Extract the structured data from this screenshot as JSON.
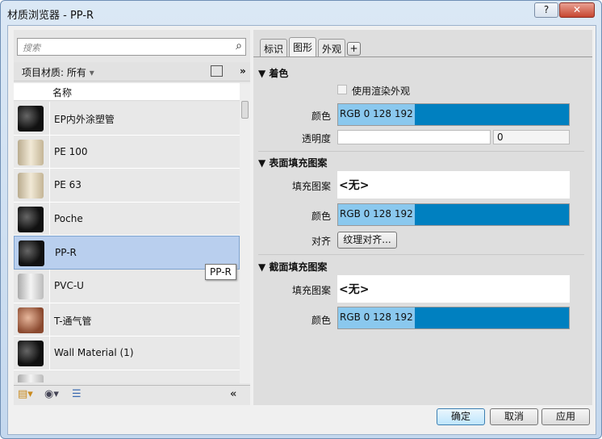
{
  "window": {
    "title": "材质浏览器 - PP-R",
    "help": "?",
    "close": "✕"
  },
  "left": {
    "search_placeholder": "搜索",
    "filter_label": "项目材质: 所有",
    "column_name": "名称",
    "materials": [
      {
        "name": "EP内外涂塑管",
        "swatch": "black"
      },
      {
        "name": "PE 100",
        "swatch": "cream"
      },
      {
        "name": "PE 63",
        "swatch": "cream"
      },
      {
        "name": "Poche",
        "swatch": "black"
      },
      {
        "name": "PP-R",
        "swatch": "black",
        "selected": true
      },
      {
        "name": "PVC-U",
        "swatch": "grey"
      },
      {
        "name": "T-通气管",
        "swatch": "copper"
      },
      {
        "name": "Wall Material (1)",
        "swatch": "black"
      }
    ],
    "tooltip": "PP-R"
  },
  "right": {
    "tabs": [
      "标识",
      "图形",
      "外观",
      "+"
    ],
    "active_tab": "图形",
    "shading": {
      "title": "着色",
      "use_render": "使用渲染外观",
      "color_label": "颜色",
      "color_value": "RGB 0 128 192",
      "transparency_label": "透明度",
      "transparency_value": "0"
    },
    "surface": {
      "title": "表面填充图案",
      "pattern_label": "填充图案",
      "pattern_value": "<无>",
      "color_label": "颜色",
      "color_value": "RGB 0 128 192",
      "align_label": "对齐",
      "align_button": "纹理对齐..."
    },
    "cut": {
      "title": "截面填充图案",
      "pattern_label": "填充图案",
      "pattern_value": "<无>",
      "color_label": "颜色",
      "color_value": "RGB 0 128 192"
    }
  },
  "buttons": {
    "ok": "确定",
    "cancel": "取消",
    "apply": "应用"
  },
  "colors": {
    "swatch": "#0080c0"
  }
}
